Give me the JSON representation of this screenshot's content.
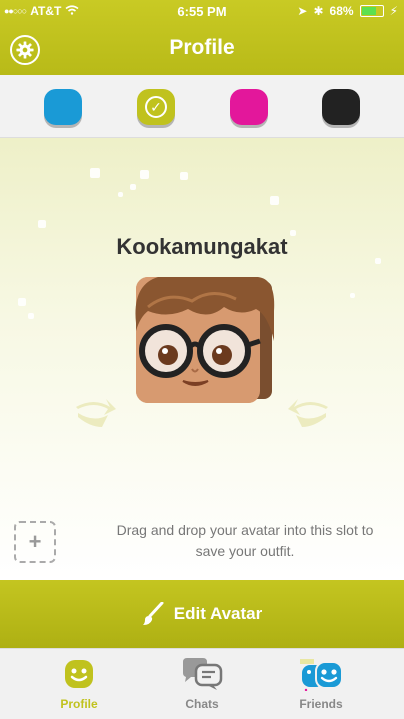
{
  "status_bar": {
    "carrier": "AT&T",
    "time": "6:55 PM",
    "battery": "68%",
    "battery_level": 0.68
  },
  "header": {
    "title": "Profile",
    "settings_icon": "gear-icon"
  },
  "color_options": [
    {
      "name": "blue",
      "color": "#1a9ad6",
      "selected": false
    },
    {
      "name": "green",
      "color": "#c0c21e",
      "selected": true
    },
    {
      "name": "pink",
      "color": "#e3179b",
      "selected": false
    },
    {
      "name": "black",
      "color": "#222222",
      "selected": false
    }
  ],
  "avatar": {
    "name": "Kookamungakat"
  },
  "outfit_slot": {
    "hint": "Drag and drop your avatar into this slot to save your outfit.",
    "icon": "plus-icon"
  },
  "edit_button": {
    "label": "Edit Avatar",
    "icon": "brush-icon"
  },
  "tabs": [
    {
      "label": "Profile",
      "icon": "smiley-icon",
      "active": true
    },
    {
      "label": "Chats",
      "icon": "chat-bubbles-icon",
      "active": false
    },
    {
      "label": "Friends",
      "icon": "friends-icon",
      "active": false
    }
  ],
  "colors": {
    "accent": "#c0c21e",
    "tab_active": "#c0c21e",
    "tab_inactive": "#888888",
    "friends_blue": "#1a9ad6"
  }
}
